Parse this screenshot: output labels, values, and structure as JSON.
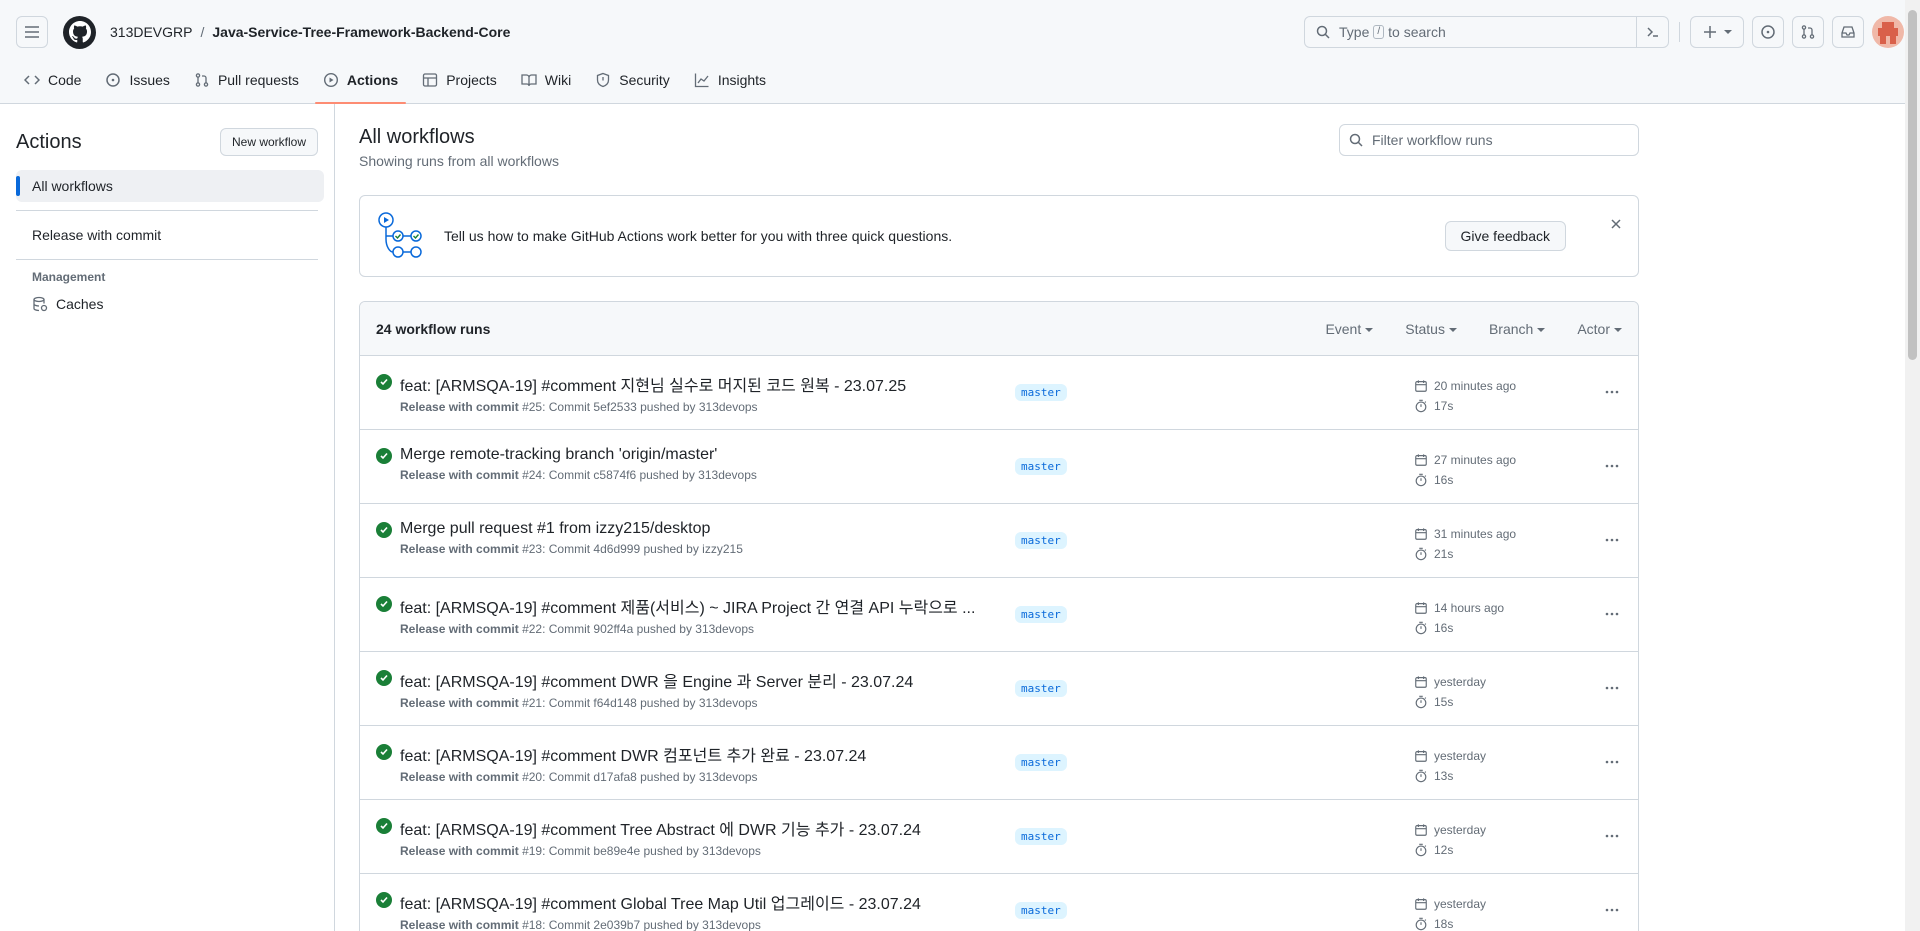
{
  "header": {
    "owner": "313DEVGRP",
    "separator": "/",
    "repo": "Java-Service-Tree-Framework-Backend-Core",
    "search_before": "Type",
    "search_key": "/",
    "search_after": "to search"
  },
  "tabs": [
    {
      "label": "Code",
      "icon": "code-icon"
    },
    {
      "label": "Issues",
      "icon": "issue-icon"
    },
    {
      "label": "Pull requests",
      "icon": "pull-request-icon"
    },
    {
      "label": "Actions",
      "icon": "play-icon"
    },
    {
      "label": "Projects",
      "icon": "table-icon"
    },
    {
      "label": "Wiki",
      "icon": "book-icon"
    },
    {
      "label": "Security",
      "icon": "shield-icon"
    },
    {
      "label": "Insights",
      "icon": "graph-icon"
    }
  ],
  "sidebar": {
    "title": "Actions",
    "new_workflow": "New workflow",
    "items": [
      {
        "label": "All workflows"
      },
      {
        "label": "Release with commit"
      }
    ],
    "group": "Management",
    "caches": "Caches"
  },
  "main": {
    "title": "All workflows",
    "subtitle": "Showing runs from all workflows",
    "filter_placeholder": "Filter workflow runs"
  },
  "banner": {
    "text": "Tell us how to make GitHub Actions work better for you with three quick questions.",
    "button": "Give feedback"
  },
  "runs_header": {
    "count": "24 workflow runs",
    "filters": [
      "Event",
      "Status",
      "Branch",
      "Actor"
    ]
  },
  "runs": [
    {
      "title": "feat: [ARMSQA-19] #comment 지현님 실수로 머지된 코드 원복 - 23.07.25",
      "workflow": "Release with commit",
      "detail": "#25: Commit 5ef2533 pushed by 313devops",
      "branch": "master",
      "when": "20 minutes ago",
      "duration": "17s"
    },
    {
      "title": "Merge remote-tracking branch 'origin/master'",
      "workflow": "Release with commit",
      "detail": "#24: Commit c5874f6 pushed by 313devops",
      "branch": "master",
      "when": "27 minutes ago",
      "duration": "16s"
    },
    {
      "title": "Merge pull request #1 from izzy215/desktop",
      "workflow": "Release with commit",
      "detail": "#23: Commit 4d6d999 pushed by izzy215",
      "branch": "master",
      "when": "31 minutes ago",
      "duration": "21s"
    },
    {
      "title": "feat: [ARMSQA-19] #comment 제품(서비스) ~ JIRA Project 간 연결 API 누락으로 ...",
      "workflow": "Release with commit",
      "detail": "#22: Commit 902ff4a pushed by 313devops",
      "branch": "master",
      "when": "14 hours ago",
      "duration": "16s"
    },
    {
      "title": "feat: [ARMSQA-19] #comment DWR 을 Engine 과 Server 분리 - 23.07.24",
      "workflow": "Release with commit",
      "detail": "#21: Commit f64d148 pushed by 313devops",
      "branch": "master",
      "when": "yesterday",
      "duration": "15s"
    },
    {
      "title": "feat: [ARMSQA-19] #comment DWR 컴포넌트 추가 완료 - 23.07.24",
      "workflow": "Release with commit",
      "detail": "#20: Commit d17afa8 pushed by 313devops",
      "branch": "master",
      "when": "yesterday",
      "duration": "13s"
    },
    {
      "title": "feat: [ARMSQA-19] #comment Tree Abstract 에 DWR 기능 추가 - 23.07.24",
      "workflow": "Release with commit",
      "detail": "#19: Commit be89e4e pushed by 313devops",
      "branch": "master",
      "when": "yesterday",
      "duration": "12s"
    },
    {
      "title": "feat: [ARMSQA-19] #comment Global Tree Map Util 업그레이드 - 23.07.24",
      "workflow": "Release with commit",
      "detail": "#18: Commit 2e039b7 pushed by 313devops",
      "branch": "master",
      "when": "yesterday",
      "duration": "18s"
    }
  ]
}
